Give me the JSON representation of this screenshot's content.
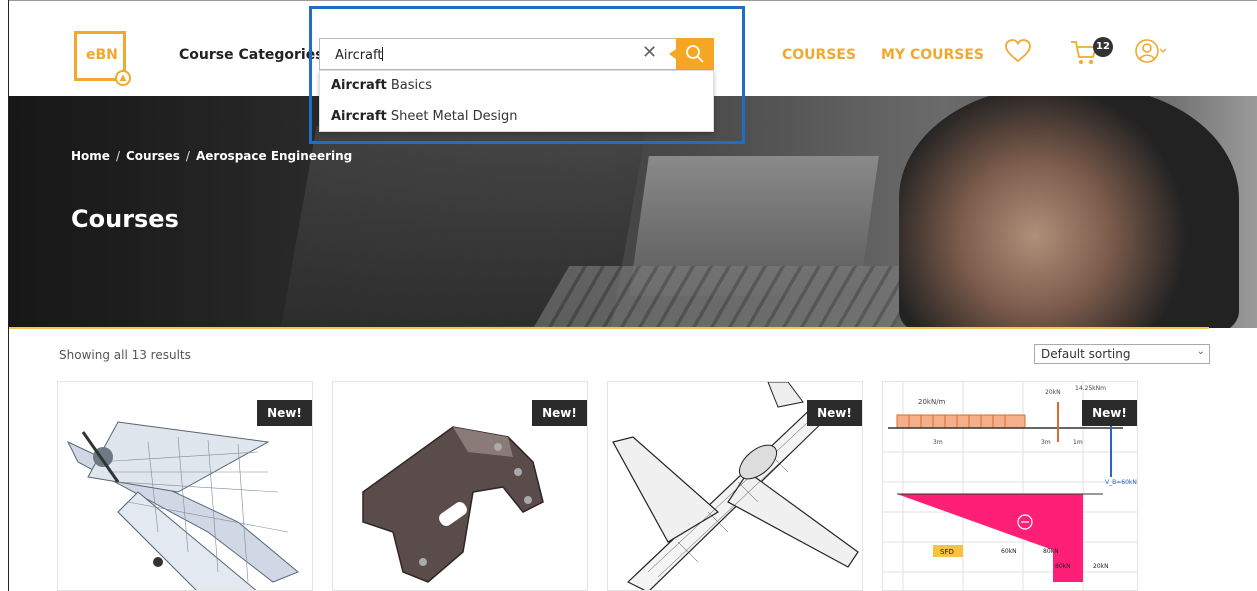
{
  "header": {
    "logo_text": "eBN",
    "course_categories": "Course Categories",
    "search": {
      "value": "Aircraft",
      "clear_icon": "close-icon",
      "button_icon": "search-icon"
    },
    "nav": {
      "courses": "COURSES",
      "my_courses": "MY COURSES"
    },
    "cart_count": "12",
    "accent_color": "#f0a92e"
  },
  "dropdown": {
    "items": [
      {
        "match": "Aircraft",
        "rest": " Basics"
      },
      {
        "match": "Aircraft",
        "rest": " Sheet Metal Design"
      }
    ]
  },
  "hero": {
    "breadcrumb": [
      "Home",
      "Courses",
      "Aerospace Engineering"
    ],
    "breadcrumb_sep": "/",
    "title": "Courses"
  },
  "listing": {
    "results": "Showing all 13 results",
    "sort": "Default sorting",
    "cards": [
      {
        "badge": "New!"
      },
      {
        "badge": "New!"
      },
      {
        "badge": "New!"
      },
      {
        "badge": "New!"
      }
    ]
  },
  "card4_labels": {
    "load": "20kN/m",
    "top_a": "20kN",
    "top_b": "14.25kNm",
    "span_a": "3m",
    "span_b": "3m",
    "span_c": "1m",
    "sfd": "SFD",
    "v_a": "60kN",
    "v_b": "80kN",
    "v_c": "80kN",
    "v_d": "20kN",
    "v_e": "60kN",
    "v_f": "V_B=60kN"
  }
}
